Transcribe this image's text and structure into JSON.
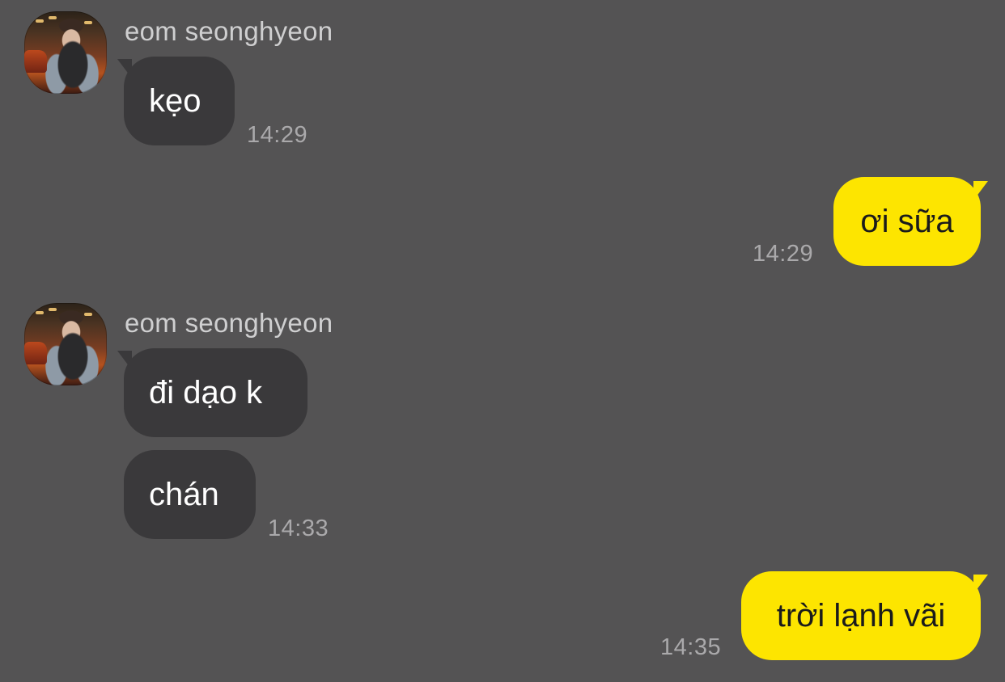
{
  "messages": [
    {
      "sender": "eom seonghyeon",
      "avatar_icon": "profile-photo",
      "text": "kẹo",
      "time": "14:29",
      "direction": "incoming"
    },
    {
      "text": "ơi sữa",
      "time": "14:29",
      "direction": "outgoing"
    },
    {
      "sender": "eom seonghyeon",
      "avatar_icon": "profile-photo",
      "text": "đi dạo k",
      "direction": "incoming"
    },
    {
      "text": "chán",
      "time": "14:33",
      "direction": "incoming"
    },
    {
      "text": "trời lạnh vãi",
      "time": "14:35",
      "direction": "outgoing"
    }
  ],
  "colors": {
    "background": "#545354",
    "incoming_bubble": "#3a393b",
    "outgoing_bubble": "#fde500",
    "sender_text": "#cfcfd0",
    "time_text": "#aaa9ab"
  }
}
